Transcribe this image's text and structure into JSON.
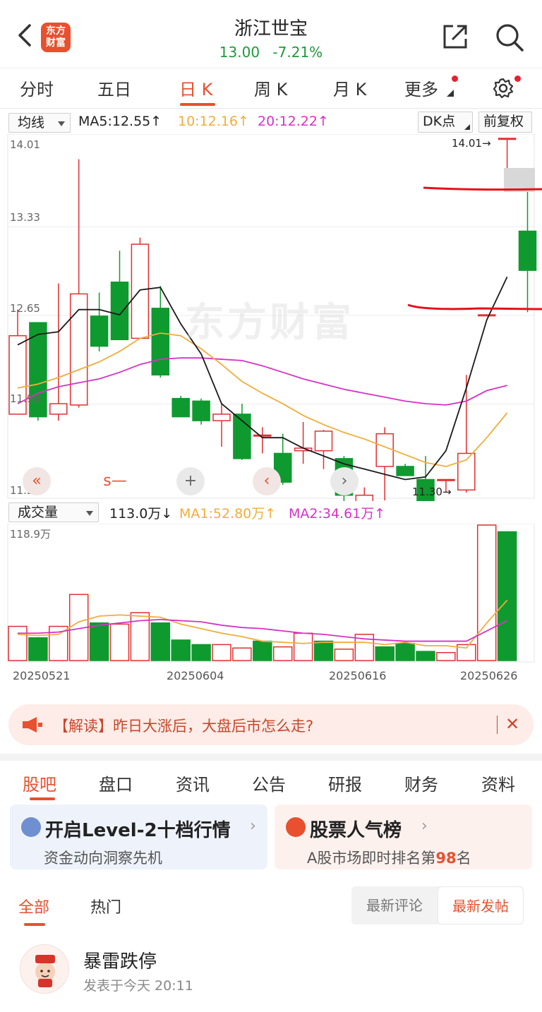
{
  "header": {
    "stock_name": "浙江世宝",
    "price": "13.00",
    "change_pct": "-7.21%",
    "logo_line1": "东方",
    "logo_line2": "财富"
  },
  "period_tabs": [
    {
      "label": "分时",
      "active": false
    },
    {
      "label": "五日",
      "active": false
    },
    {
      "label": "日 K",
      "active": true
    },
    {
      "label": "周 K",
      "active": false
    },
    {
      "label": "月 K",
      "active": false
    },
    {
      "label": "更多",
      "active": false
    }
  ],
  "kchart_toolbar": {
    "indicator": "均线",
    "ma5": "MA5:12.55↑",
    "ma10": "10:12.16↑",
    "ma20": "20:12.22↑",
    "dk_label": "DK点",
    "adjust_label": "前复权"
  },
  "kchart_axis": {
    "y_labels": [
      "14.01",
      "13.33",
      "12.65",
      "11.98",
      "11.30"
    ],
    "high_marker": "14.01→",
    "low_marker": "11.30→",
    "watermark": "东方财富"
  },
  "vol_toolbar": {
    "indicator": "成交量",
    "vol": "113.0万↓",
    "ma1": "MA1:52.80万↑",
    "ma2": "MA2:34.61万↑",
    "max_label": "118.9万"
  },
  "dates": [
    "20250521",
    "20250604",
    "20250616",
    "20250626"
  ],
  "nav_controls": [
    {
      "name": "fast-back",
      "glyph": "«"
    },
    {
      "name": "shrink",
      "glyph": "s—"
    },
    {
      "name": "zoom-in",
      "glyph": "+"
    },
    {
      "name": "prev",
      "glyph": "‹"
    },
    {
      "name": "next",
      "glyph": "›"
    }
  ],
  "banner": {
    "text": "【解读】昨日大涨后，大盘后市怎么走?",
    "close": "✕"
  },
  "section_tabs": [
    "股吧",
    "盘口",
    "资讯",
    "公告",
    "研报",
    "财务",
    "资料"
  ],
  "cards": {
    "level2_title": "开启Level-2十档行情",
    "level2_sub": "资金动向洞察先机",
    "popularity_title": "股票人气榜",
    "popularity_sub_pre": "A股市场即时排名第",
    "popularity_rank": "98",
    "popularity_sub_post": "名"
  },
  "feed_tabs": [
    "全部",
    "热门"
  ],
  "sort_options": [
    "最新评论",
    "最新发帖"
  ],
  "post": {
    "title": "暴雷跌停",
    "time": "发表于今天 20:11"
  },
  "colors": {
    "up": "#e03030",
    "down": "#0f9a2f",
    "ma5": "#1a1a1a",
    "ma10": "#f0ad3c",
    "ma20": "#d632c6",
    "accent": "#e8502f"
  },
  "chart_data": {
    "type": "candlestick",
    "y_range": [
      11.3,
      14.01
    ],
    "candles": [
      {
        "o": 11.9,
        "h": 12.7,
        "l": 11.9,
        "c": 12.5
      },
      {
        "o": 12.6,
        "h": 12.6,
        "l": 11.85,
        "c": 11.88
      },
      {
        "o": 11.9,
        "h": 12.9,
        "l": 11.85,
        "c": 11.98
      },
      {
        "o": 11.97,
        "h": 13.85,
        "l": 11.95,
        "c": 12.82
      },
      {
        "o": 12.65,
        "h": 12.83,
        "l": 12.38,
        "c": 12.42
      },
      {
        "o": 12.91,
        "h": 13.15,
        "l": 12.48,
        "c": 12.47
      },
      {
        "o": 12.48,
        "h": 13.25,
        "l": 12.48,
        "c": 13.2
      },
      {
        "o": 12.71,
        "h": 12.88,
        "l": 12.18,
        "c": 12.2
      },
      {
        "o": 12.02,
        "h": 12.04,
        "l": 11.88,
        "c": 11.88
      },
      {
        "o": 12.0,
        "h": 12.02,
        "l": 11.82,
        "c": 11.85
      },
      {
        "o": 11.85,
        "h": 11.98,
        "l": 11.65,
        "c": 11.9
      },
      {
        "o": 11.9,
        "h": 11.98,
        "l": 11.55,
        "c": 11.56
      },
      {
        "o": 11.74,
        "h": 11.8,
        "l": 11.6,
        "c": 11.74
      },
      {
        "o": 11.6,
        "h": 11.75,
        "l": 11.36,
        "c": 11.38
      },
      {
        "o": 11.62,
        "h": 11.84,
        "l": 11.52,
        "c": 11.64
      },
      {
        "o": 11.62,
        "h": 11.78,
        "l": 11.48,
        "c": 11.77
      },
      {
        "o": 11.56,
        "h": 11.58,
        "l": 11.18,
        "c": 11.28
      },
      {
        "o": 11.12,
        "h": 11.34,
        "l": 11.03,
        "c": 11.28
      },
      {
        "o": 11.5,
        "h": 11.8,
        "l": 11.24,
        "c": 11.75
      },
      {
        "o": 11.5,
        "h": 11.52,
        "l": 11.43,
        "c": 11.43
      },
      {
        "o": 11.4,
        "h": 11.58,
        "l": 11.15,
        "c": 11.14
      },
      {
        "o": 11.4,
        "h": 11.4,
        "l": 11.3,
        "c": 11.4
      },
      {
        "o": 11.32,
        "h": 12.2,
        "l": 11.3,
        "c": 11.6
      },
      {
        "o": 12.66,
        "h": 12.66,
        "l": 12.65,
        "c": 12.66
      },
      {
        "o": 14.01,
        "h": 14.01,
        "l": 13.7,
        "c": 14.01
      },
      {
        "o": 13.3,
        "h": 13.7,
        "l": 12.68,
        "c": 13.0
      }
    ],
    "ma5": [
      12.43,
      12.51,
      12.53,
      12.7,
      12.7,
      12.66,
      12.85,
      12.87,
      12.59,
      12.36,
      11.98,
      11.85,
      11.72,
      11.72,
      11.64,
      11.58,
      11.52,
      11.48,
      11.44,
      11.4,
      11.42,
      11.62,
      12.1,
      12.62,
      12.95
    ],
    "ma10": [
      12.1,
      12.13,
      12.18,
      12.24,
      12.3,
      12.38,
      12.48,
      12.52,
      12.5,
      12.4,
      12.28,
      12.15,
      12.06,
      11.98,
      11.89,
      11.82,
      11.76,
      11.71,
      11.65,
      11.59,
      11.53,
      11.5,
      11.55,
      11.72,
      11.91
    ],
    "ma20": [
      11.98,
      12.06,
      12.11,
      12.14,
      12.17,
      12.22,
      12.28,
      12.32,
      12.33,
      12.33,
      12.32,
      12.31,
      12.27,
      12.22,
      12.17,
      12.13,
      12.09,
      12.06,
      12.03,
      12.0,
      11.98,
      11.97,
      12.0,
      12.08,
      12.12
    ],
    "volume": [
      30,
      20,
      30,
      58,
      33,
      32,
      42,
      33,
      18,
      14,
      14,
      11,
      17,
      12,
      24,
      17,
      10,
      23,
      12,
      15,
      8,
      7,
      14,
      118.9,
      113.0
    ],
    "volume_up": [
      true,
      false,
      true,
      true,
      false,
      true,
      true,
      false,
      false,
      false,
      true,
      true,
      false,
      true,
      true,
      false,
      true,
      true,
      false,
      false,
      false,
      true,
      true,
      true,
      false
    ],
    "vol_ma1": [
      23,
      22,
      23,
      34,
      39,
      40,
      39,
      38,
      32,
      28,
      24,
      21,
      17,
      16,
      15,
      16,
      16,
      16,
      14,
      16,
      13,
      13,
      11,
      33,
      53
    ],
    "vol_ma2": [
      24,
      24,
      25,
      28,
      31,
      33,
      35,
      36,
      35,
      34,
      31,
      29,
      28,
      26,
      24,
      23,
      21,
      19,
      18,
      17,
      17,
      17,
      17,
      26,
      35
    ]
  }
}
